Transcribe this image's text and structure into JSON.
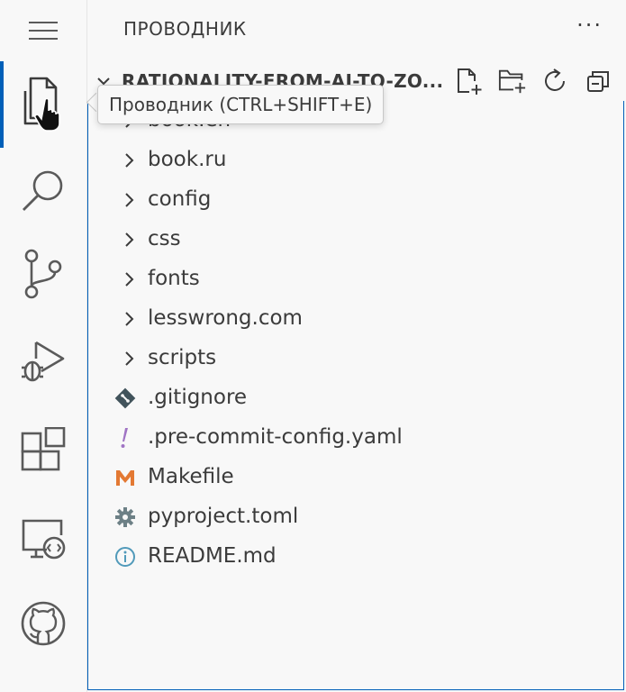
{
  "activity_bar": {
    "items": [
      {
        "icon": "menu-icon"
      },
      {
        "icon": "explorer-icon",
        "active": true
      },
      {
        "icon": "search-icon"
      },
      {
        "icon": "source-control-icon"
      },
      {
        "icon": "run-debug-icon"
      },
      {
        "icon": "extensions-icon"
      },
      {
        "icon": "remote-explorer-icon"
      },
      {
        "icon": "github-icon"
      }
    ],
    "accent_color": "#005fb8"
  },
  "sidebar": {
    "title": "ПРОВОДНИК",
    "more_label": "···",
    "section": {
      "title": "RATIONALITY-FROM-AI-TO-ZO...",
      "actions": [
        "new-file-icon",
        "new-folder-icon",
        "refresh-icon",
        "collapse-all-icon"
      ]
    }
  },
  "tooltip": {
    "text": "Проводник (CTRL+SHIFT+E)"
  },
  "tree": {
    "items": [
      {
        "label": "book.en",
        "type": "folder"
      },
      {
        "label": "book.ru",
        "type": "folder"
      },
      {
        "label": "config",
        "type": "folder"
      },
      {
        "label": "css",
        "type": "folder"
      },
      {
        "label": "fonts",
        "type": "folder"
      },
      {
        "label": "lesswrong.com",
        "type": "folder"
      },
      {
        "label": "scripts",
        "type": "folder"
      },
      {
        "label": ".gitignore",
        "type": "file",
        "icon": "git-icon"
      },
      {
        "label": ".pre-commit-config.yaml",
        "type": "file",
        "icon": "yaml-icon"
      },
      {
        "label": "Makefile",
        "type": "file",
        "icon": "makefile-icon"
      },
      {
        "label": "pyproject.toml",
        "type": "file",
        "icon": "settings-gear-icon"
      },
      {
        "label": "README.md",
        "type": "file",
        "icon": "info-icon"
      }
    ]
  }
}
